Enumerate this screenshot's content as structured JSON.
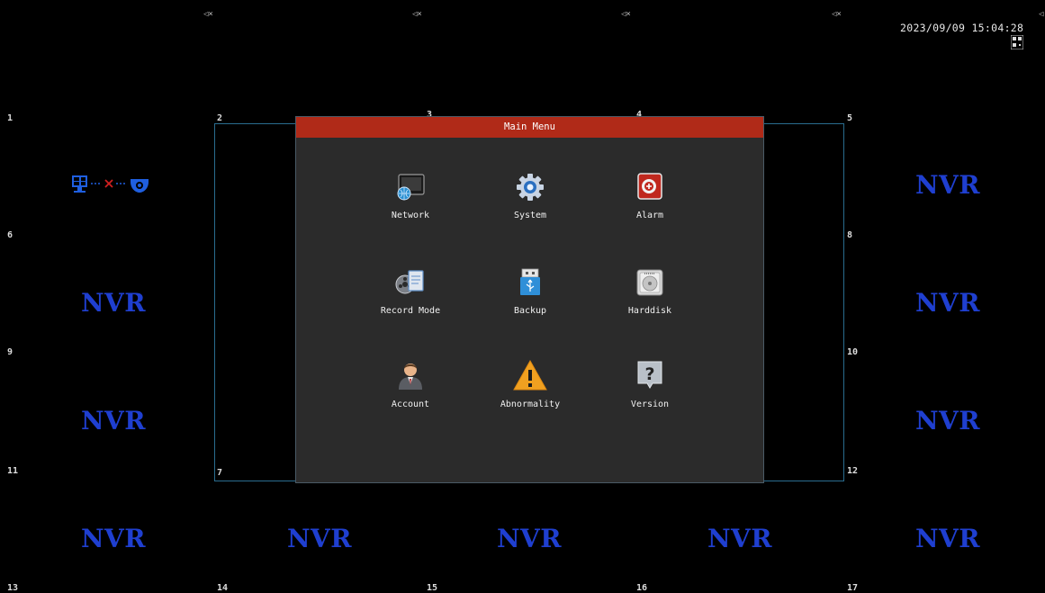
{
  "status": {
    "datetime": "2023/09/09 15:04:28",
    "qr_icon": "qr-code-icon",
    "mute_icon": "speaker-muted-icon"
  },
  "channels": {
    "c1": "1",
    "c2": "2",
    "c3": "3",
    "c4": "4",
    "c5": "5",
    "c6": "6",
    "c7": "7",
    "c8": "8",
    "c9": "9",
    "c10": "10",
    "c11": "11",
    "c12": "12",
    "c13": "13",
    "c14": "14",
    "c15": "15",
    "c16": "16",
    "c17": "17"
  },
  "nvr_label": "NVR",
  "connection_icon": "monitor-disconnected-camera-icon",
  "menu": {
    "title": "Main Menu",
    "items": [
      {
        "label": "Network",
        "icon": "network-icon"
      },
      {
        "label": "System",
        "icon": "gear-icon"
      },
      {
        "label": "Alarm",
        "icon": "alarm-icon"
      },
      {
        "label": "Record Mode",
        "icon": "record-mode-icon"
      },
      {
        "label": "Backup",
        "icon": "usb-drive-icon"
      },
      {
        "label": "Harddisk",
        "icon": "harddisk-icon"
      },
      {
        "label": "Account",
        "icon": "user-icon"
      },
      {
        "label": "Abnormality",
        "icon": "warning-icon"
      },
      {
        "label": "Version",
        "icon": "question-icon"
      }
    ]
  },
  "colors": {
    "nvr": "#1f3fd0",
    "menu_bar": "#b02a18",
    "menu_bg": "#2b2b2b",
    "frame": "#2a6d8f"
  }
}
